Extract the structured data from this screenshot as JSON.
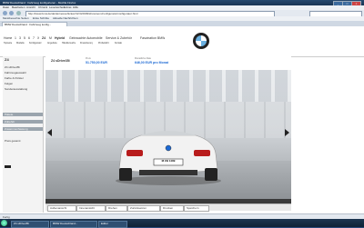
{
  "browser": {
    "title": "BMW Deutschland : Fahrzeug konfigurieren - Mozilla Firefox",
    "window_buttons": [
      "_",
      "□",
      "×"
    ],
    "menu": [
      "Datei",
      "Bearbeiten",
      "Ansicht",
      "Chronik",
      "Lesezeichen",
      "Extras",
      "Hilfe"
    ],
    "url": "http://www.bmw.de/de/de/newvehicles/z4/z4/2009/showroom/configurator/configurator.html",
    "bookmarks": [
      "Meistbesuchte Seiten",
      "Erste Schritte",
      "Aktuelle Nachrichten"
    ],
    "tabs": [
      {
        "label": "BMW Deutschland : Fahrzeug konfig...",
        "active": true
      }
    ],
    "status": "Fertig",
    "taskbar": [
      "Z4 sDrive35i",
      "BMW Deutschland...",
      "Editor"
    ]
  },
  "bmw": {
    "top_nav": [
      "Home",
      "1",
      "3",
      "5",
      "6",
      "7",
      "X",
      "Z4",
      "M",
      "Hybrid",
      "Gebrauchte Automobile",
      "Service & Zubehör",
      "Faszination BMW"
    ],
    "sub_nav": [
      "Topseite",
      "Modelle",
      "Konfigurator",
      "Angebote",
      "Händlersuche",
      "Finanzierung",
      "Probefahrt",
      "Kontakt"
    ],
    "logo": "BMW",
    "sidebar": {
      "title": "Z4",
      "items": [
        {
          "label": "Z4 sDrive35i",
          "highlight": false
        },
        {
          "label": "Fahrzeugauswahl",
          "highlight": false
        },
        {
          "label": "Farbe & Polster",
          "highlight": false
        },
        {
          "label": "Felgen",
          "highlight": false
        },
        {
          "label": "Sonderausstattung",
          "highlight": false
        },
        {
          "label": "Pakete",
          "highlight": true
        },
        {
          "label": "Zubehör",
          "highlight": false
        },
        {
          "label": "Zusammenfassung",
          "highlight": false
        }
      ],
      "note": "Preis gesamt"
    },
    "config": {
      "model": "Z4 sDrive35i",
      "price_label": "Preis",
      "price": "51.750,00 EUR",
      "rate_label": "Monatliche Rate",
      "rate": "646,00 EUR pro Monat",
      "plate": "M ZB 1489"
    },
    "controls": [
      "Außenansicht",
      "Innenansicht",
      "Drehen",
      "Zurücksetzen",
      "Drucken",
      "Speichern"
    ]
  }
}
